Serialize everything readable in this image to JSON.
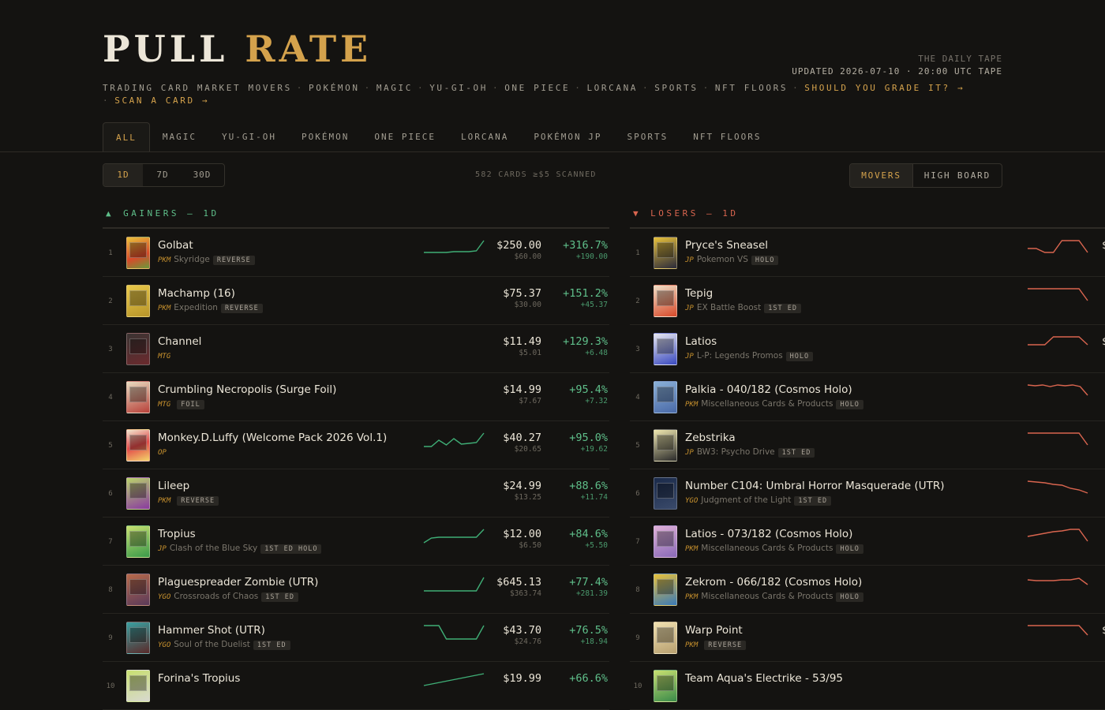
{
  "brand": {
    "word1": "PULL",
    "word2": "RATE"
  },
  "tape": {
    "label": "THE DAILY TAPE",
    "updated": "UPDATED 2026-07-10 · 20:00 UTC TAPE"
  },
  "subnav": {
    "items": [
      "TRADING CARD MARKET MOVERS",
      "POKÉMON",
      "MAGIC",
      "YU-GI-OH",
      "ONE PIECE",
      "LORCANA",
      "SPORTS",
      "NFT FLOORS"
    ],
    "grade_link": "SHOULD YOU GRADE IT? →",
    "scan_link": "SCAN A CARD →",
    "separator": "·"
  },
  "tabs": [
    "ALL",
    "MAGIC",
    "YU-GI-OH",
    "POKÉMON",
    "ONE PIECE",
    "LORCANA",
    "POKÉMON JP",
    "SPORTS",
    "NFT FLOORS"
  ],
  "active_tab": "ALL",
  "periods": [
    "1D",
    "7D",
    "30D"
  ],
  "active_period": "1D",
  "scanned": "582 CARDS ≥$5 SCANNED",
  "views": [
    "MOVERS",
    "HIGH BOARD"
  ],
  "active_view": "MOVERS",
  "colors": {
    "accent": "#d4a24c",
    "gain": "#5fbf8a",
    "loss": "#d9654f",
    "background": "#141311"
  },
  "gainers": {
    "arrow": "▲",
    "title": "GAINERS — 1D",
    "rows": [
      {
        "rank": "1",
        "name": "Golbat",
        "code": "PKM",
        "set": "Skyridge",
        "tag": "REVERSE",
        "price": "$250.00",
        "prev": "$60.00",
        "change": "+316.7%",
        "abs": "+190.00",
        "spark": [
          20,
          20,
          20,
          20,
          19,
          19,
          19,
          18,
          5
        ]
      },
      {
        "rank": "2",
        "name": "Machamp (16)",
        "code": "PKM",
        "set": "Expedition",
        "tag": "REVERSE",
        "price": "$75.37",
        "prev": "$30.00",
        "change": "+151.2%",
        "abs": "+45.37",
        "spark": null
      },
      {
        "rank": "3",
        "name": "Channel",
        "code": "MTG",
        "set": "",
        "tag": "",
        "price": "$11.49",
        "prev": "$5.01",
        "change": "+129.3%",
        "abs": "+6.48",
        "spark": null
      },
      {
        "rank": "4",
        "name": "Crumbling Necropolis (Surge Foil)",
        "code": "MTG",
        "set": "",
        "tag": "FOIL",
        "price": "$14.99",
        "prev": "$7.67",
        "change": "+95.4%",
        "abs": "+7.32",
        "spark": null
      },
      {
        "rank": "5",
        "name": "Monkey.D.Luffy (Welcome Pack 2026 Vol.1)",
        "code": "OP",
        "set": "",
        "tag": "",
        "price": "$40.27",
        "prev": "$20.65",
        "change": "+95.0%",
        "abs": "+19.62",
        "spark": [
          22,
          22,
          14,
          20,
          12,
          19,
          18,
          17,
          5
        ]
      },
      {
        "rank": "6",
        "name": "Lileep",
        "code": "PKM",
        "set": "",
        "tag": "REVERSE",
        "price": "$24.99",
        "prev": "$13.25",
        "change": "+88.6%",
        "abs": "+11.74",
        "spark": null
      },
      {
        "rank": "7",
        "name": "Tropius",
        "code": "JP",
        "set": "Clash of the Blue Sky",
        "tag": "1ST ED HOLO",
        "price": "$12.00",
        "prev": "$6.50",
        "change": "+84.6%",
        "abs": "+5.50",
        "spark": [
          22,
          16,
          15,
          15,
          15,
          15,
          15,
          15,
          5
        ]
      },
      {
        "rank": "8",
        "name": "Plaguespreader Zombie (UTR)",
        "code": "YGO",
        "set": "Crossroads of Chaos",
        "tag": "1ST ED",
        "price": "$645.13",
        "prev": "$363.74",
        "change": "+77.4%",
        "abs": "+281.39",
        "spark": [
          22,
          22,
          22,
          22,
          22,
          22,
          22,
          22,
          5
        ]
      },
      {
        "rank": "9",
        "name": "Hammer Shot (UTR)",
        "code": "YGO",
        "set": "Soul of the Duelist",
        "tag": "1ST ED",
        "price": "$43.70",
        "prev": "$24.76",
        "change": "+76.5%",
        "abs": "+18.94",
        "spark": [
          5,
          5,
          5,
          22,
          22,
          22,
          22,
          22,
          5
        ]
      },
      {
        "rank": "10",
        "name": "Forina's Tropius",
        "code": "",
        "set": "",
        "tag": "",
        "price": "$19.99",
        "prev": "",
        "change": "+66.6%",
        "abs": "",
        "spark": [
          20,
          5
        ]
      }
    ]
  },
  "losers": {
    "arrow": "▼",
    "title": "LOSERS — 1D",
    "rows": [
      {
        "rank": "1",
        "name": "Pryce's Sneasel",
        "code": "JP",
        "set": "Pokemon VS",
        "tag": "HOLO",
        "price": "$",
        "spark": [
          15,
          15,
          20,
          20,
          5,
          5,
          5,
          20
        ]
      },
      {
        "rank": "2",
        "name": "Tepig",
        "code": "JP",
        "set": "EX Battle Boost",
        "tag": "1ST ED",
        "price": "",
        "spark": [
          5,
          5,
          5,
          5,
          5,
          5,
          5,
          20
        ]
      },
      {
        "rank": "3",
        "name": "Latios",
        "code": "JP",
        "set": "L-P: Legends Promos",
        "tag": "HOLO",
        "price": "$",
        "spark": [
          15,
          15,
          15,
          5,
          5,
          5,
          5,
          15
        ]
      },
      {
        "rank": "4",
        "name": "Palkia - 040/182 (Cosmos Holo)",
        "code": "PKM",
        "set": "Miscellaneous Cards & Products",
        "tag": "HOLO",
        "price": "",
        "spark": [
          5,
          6,
          5,
          7,
          5,
          6,
          5,
          7,
          18
        ]
      },
      {
        "rank": "5",
        "name": "Zebstrika",
        "code": "JP",
        "set": "BW3: Psycho Drive",
        "tag": "1ST ED",
        "price": "",
        "spark": [
          5,
          5,
          5,
          5,
          5,
          5,
          5,
          20
        ]
      },
      {
        "rank": "6",
        "name": "Number C104: Umbral Horror Masquerade (UTR)",
        "code": "YGO",
        "set": "Judgment of the Light",
        "tag": "1ST ED",
        "price": "",
        "spark": [
          5,
          6,
          7,
          9,
          10,
          14,
          16,
          20
        ]
      },
      {
        "rank": "7",
        "name": "Latios - 073/182 (Cosmos Holo)",
        "code": "PKM",
        "set": "Miscellaneous Cards & Products",
        "tag": "HOLO",
        "price": "",
        "spark": [
          14,
          12,
          10,
          8,
          7,
          5,
          5,
          20
        ]
      },
      {
        "rank": "8",
        "name": "Zekrom - 066/182 (Cosmos Holo)",
        "code": "PKM",
        "set": "Miscellaneous Cards & Products",
        "tag": "HOLO",
        "price": "",
        "spark": [
          8,
          9,
          9,
          9,
          8,
          8,
          6,
          14
        ]
      },
      {
        "rank": "9",
        "name": "Warp Point",
        "code": "PKM",
        "set": "",
        "tag": "REVERSE",
        "price": "$",
        "spark": [
          5,
          5,
          5,
          5,
          5,
          5,
          5,
          17
        ]
      },
      {
        "rank": "10",
        "name": "Team Aqua's Electrike - 53/95",
        "code": "",
        "set": "",
        "tag": "",
        "price": "",
        "spark": null
      }
    ]
  }
}
